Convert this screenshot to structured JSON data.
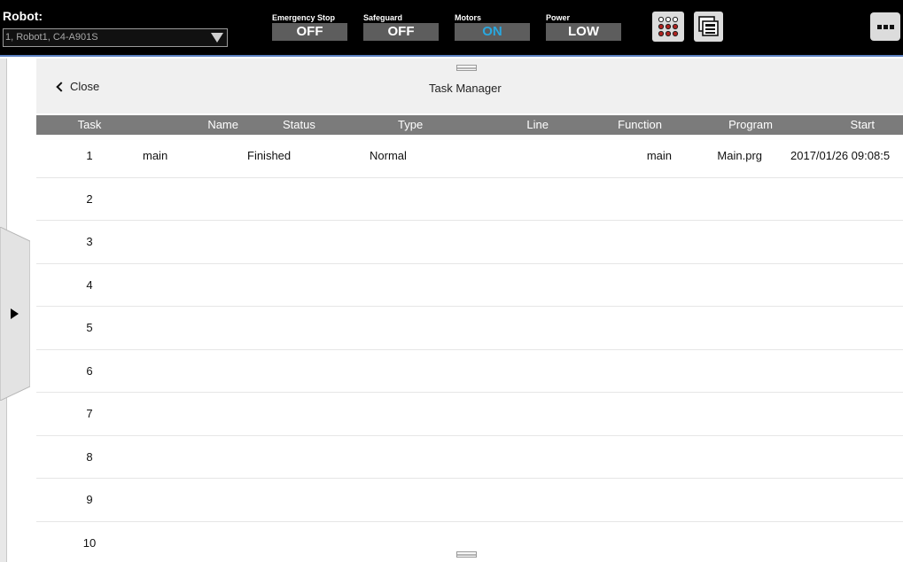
{
  "topbar": {
    "robot_label": "Robot:",
    "robot_select_value": "1, Robot1, C4-A901S",
    "emergency_stop": {
      "label": "Emergency Stop",
      "value": "OFF"
    },
    "safeguard": {
      "label": "Safeguard",
      "value": "OFF"
    },
    "motors": {
      "label": "Motors",
      "value": "ON"
    },
    "power": {
      "label": "Power",
      "value": "LOW"
    },
    "motors_on_color": "#29a8e0",
    "accent_line_color": "#5a7fc0",
    "icons": [
      "io-monitor-icon",
      "task-windows-icon",
      "more-menu-icon"
    ]
  },
  "header": {
    "close_label": "Close",
    "title": "Task Manager"
  },
  "table": {
    "columns": [
      "Task",
      "Name",
      "Status",
      "Type",
      "Line",
      "Function",
      "Program",
      "Start"
    ],
    "rows": [
      {
        "task": "1",
        "name": "main",
        "status": "Finished",
        "type": "Normal",
        "line": "",
        "function": "main",
        "program": "Main.prg",
        "start": "2017/01/26 09:08:5"
      },
      {
        "task": "2",
        "name": "",
        "status": "",
        "type": "",
        "line": "",
        "function": "",
        "program": "",
        "start": ""
      },
      {
        "task": "3",
        "name": "",
        "status": "",
        "type": "",
        "line": "",
        "function": "",
        "program": "",
        "start": ""
      },
      {
        "task": "4",
        "name": "",
        "status": "",
        "type": "",
        "line": "",
        "function": "",
        "program": "",
        "start": ""
      },
      {
        "task": "5",
        "name": "",
        "status": "",
        "type": "",
        "line": "",
        "function": "",
        "program": "",
        "start": ""
      },
      {
        "task": "6",
        "name": "",
        "status": "",
        "type": "",
        "line": "",
        "function": "",
        "program": "",
        "start": ""
      },
      {
        "task": "7",
        "name": "",
        "status": "",
        "type": "",
        "line": "",
        "function": "",
        "program": "",
        "start": ""
      },
      {
        "task": "8",
        "name": "",
        "status": "",
        "type": "",
        "line": "",
        "function": "",
        "program": "",
        "start": ""
      },
      {
        "task": "9",
        "name": "",
        "status": "",
        "type": "",
        "line": "",
        "function": "",
        "program": "",
        "start": ""
      },
      {
        "task": "10",
        "name": "",
        "status": "",
        "type": "",
        "line": "",
        "function": "",
        "program": "",
        "start": ""
      }
    ]
  }
}
